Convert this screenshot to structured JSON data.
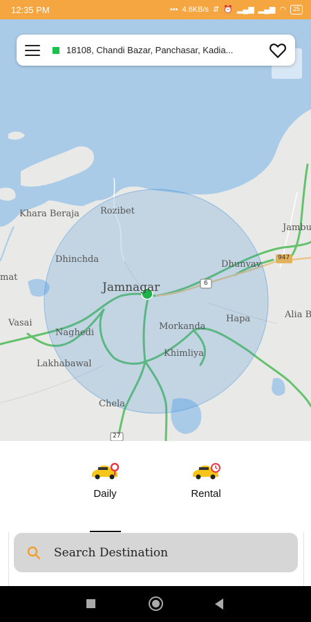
{
  "status_bar": {
    "time": "12:35 PM",
    "network_speed": "4.6KB/s",
    "battery": "25"
  },
  "top_search": {
    "address": "18108, Chandi Bazar, Panchasar, Kadia..."
  },
  "map": {
    "labels": [
      "Khara Beraja",
      "Rozibet",
      "Dhinchda",
      "Jamnagar",
      "Dhunvav",
      "Vasai",
      "Naghedi",
      "Morkanda",
      "Hapa",
      "Alia B",
      "Khimliya",
      "Lakhabawal",
      "Chela",
      "Jambu",
      "mat",
      "947",
      "6",
      "27"
    ],
    "colors": {
      "water": "#a9cbe8",
      "land": "#e9e9e7",
      "road": "#63c26b",
      "radius": "#3a8fd6",
      "marker": "#20b24a"
    }
  },
  "ride_tabs": [
    {
      "label": "Daily",
      "selected": true
    },
    {
      "label": "Rental",
      "selected": false
    }
  ],
  "destination": {
    "placeholder": "Search Destination"
  },
  "colors": {
    "status_bar": "#f6a640",
    "accent": "#19c24a",
    "search_bg": "#d6d6d6"
  }
}
